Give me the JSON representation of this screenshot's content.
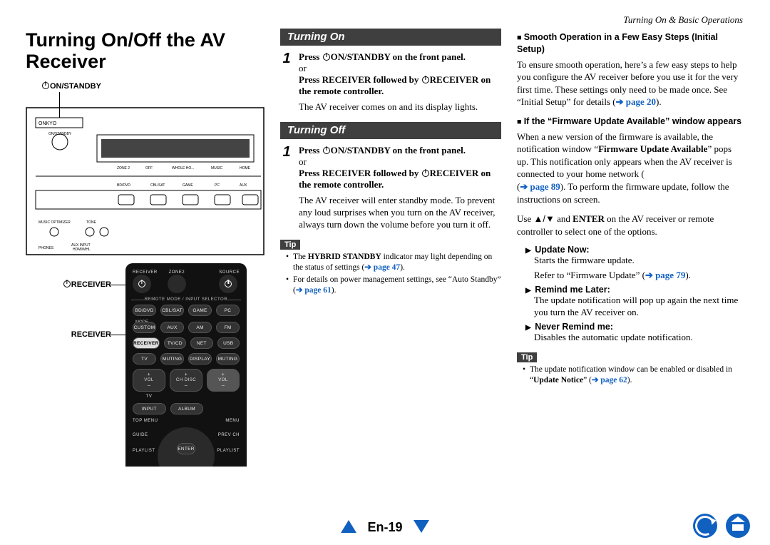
{
  "breadcrumb": "Turning On & Basic Operations",
  "title": "Turning On/Off the AV Receiver",
  "panel_label": "ON/STANDBY",
  "remote_labels": {
    "receiver_power": "RECEIVER",
    "receiver_btn": "RECEIVER"
  },
  "remote": {
    "row1": [
      "RECEIVER",
      "ZONE2",
      "",
      "SOURCE"
    ],
    "sep": "REMOTE MODE / INPUT SELECTOR",
    "grid": [
      [
        "BD/DVD",
        "CBL/SAT",
        "GAME",
        "PC"
      ],
      [
        "CUSTOM",
        "AUX",
        "AM",
        "FM"
      ],
      [
        "RECEIVER",
        "TV/CD",
        "NET",
        "USB"
      ],
      [
        "TV",
        "MUTING",
        "DISPLAY",
        "MUTING"
      ]
    ],
    "mode_label": "MODE",
    "vol_rows": [
      "TV",
      "VOL",
      "CH DISC",
      "VOL"
    ],
    "input_label": "INPUT",
    "album_label": "ALBUM",
    "bottom_row": [
      "TOP MENU",
      "MENU"
    ],
    "nav_row": [
      "GUIDE",
      "",
      "PREV CH"
    ],
    "play_row": [
      "PLAYLIST",
      "ENTER",
      "PLAYLIST"
    ]
  },
  "col2": {
    "turning_on": {
      "heading": "Turning On",
      "step1a": "Press ",
      "step1b": "ON/STANDBY on the front panel.",
      "or": "or",
      "step1c": "Press RECEIVER followed by ",
      "step1d": "RECEIVER on the remote controller.",
      "body": "The AV receiver comes on and its display lights."
    },
    "turning_off": {
      "heading": "Turning Off",
      "step1a": "Press ",
      "step1b": "ON/STANDBY on the front panel.",
      "or": "or",
      "step1c": "Press RECEIVER followed by ",
      "step1d": "RECEIVER on the remote controller.",
      "body": "The AV receiver will enter standby mode. To prevent any loud surprises when you turn on the AV receiver, always turn down the volume before you turn it off."
    },
    "tip_label": "Tip",
    "tips": [
      {
        "a": "The ",
        "b": "HYBRID STANDBY",
        "c": " indicator may light depending on the status of settings (",
        "link": "➔ page 47",
        "d": ")."
      },
      {
        "a": "For details on power management settings, see “Auto Standby” (",
        "link": "➔ page 61",
        "d": ")."
      }
    ]
  },
  "col3": {
    "h1": "Smooth Operation in a Few Easy Steps (Initial Setup)",
    "p1a": "To ensure smooth operation, here’s a few easy steps to help you configure the AV receiver before you use it for the very first time. These settings only need to be made once. See “Initial Setup” for details (",
    "p1link": "➔ page 20",
    "p1b": ").",
    "h2": "If the “Firmware Update Available” window appears",
    "p2a": "When a new version of the firmware is available, the notification window “",
    "p2b": "Firmware Update Available",
    "p2c": "” pops up. This notification only appears when the AV receiver is connected to your home network (",
    "p2link": "➔ page 89",
    "p2d": "). To perform the firmware update, follow the instructions on screen.",
    "p3a": "Use ",
    "p3arrows": "▲/▼",
    "p3b": " and ",
    "p3enter": "ENTER",
    "p3c": " on the AV receiver or remote controller to select one of the options.",
    "items": [
      {
        "title": "Update Now",
        "l1": "Starts the firmware update.",
        "l2a": "Refer to “Firmware Update” (",
        "l2link": "➔ page 79",
        "l2b": ")."
      },
      {
        "title": "Remind me Later",
        "l1": "The update notification will pop up again the next time you turn the AV receiver on."
      },
      {
        "title": "Never Remind me",
        "l1": "Disables the automatic update notification."
      }
    ],
    "tip_label": "Tip",
    "tip_a": "The update notification window can be enabled or disabled in “",
    "tip_b": "Update Notice",
    "tip_c": "” (",
    "tip_link": "➔ page 62",
    "tip_d": ")."
  },
  "footer": {
    "page": "En-19"
  }
}
